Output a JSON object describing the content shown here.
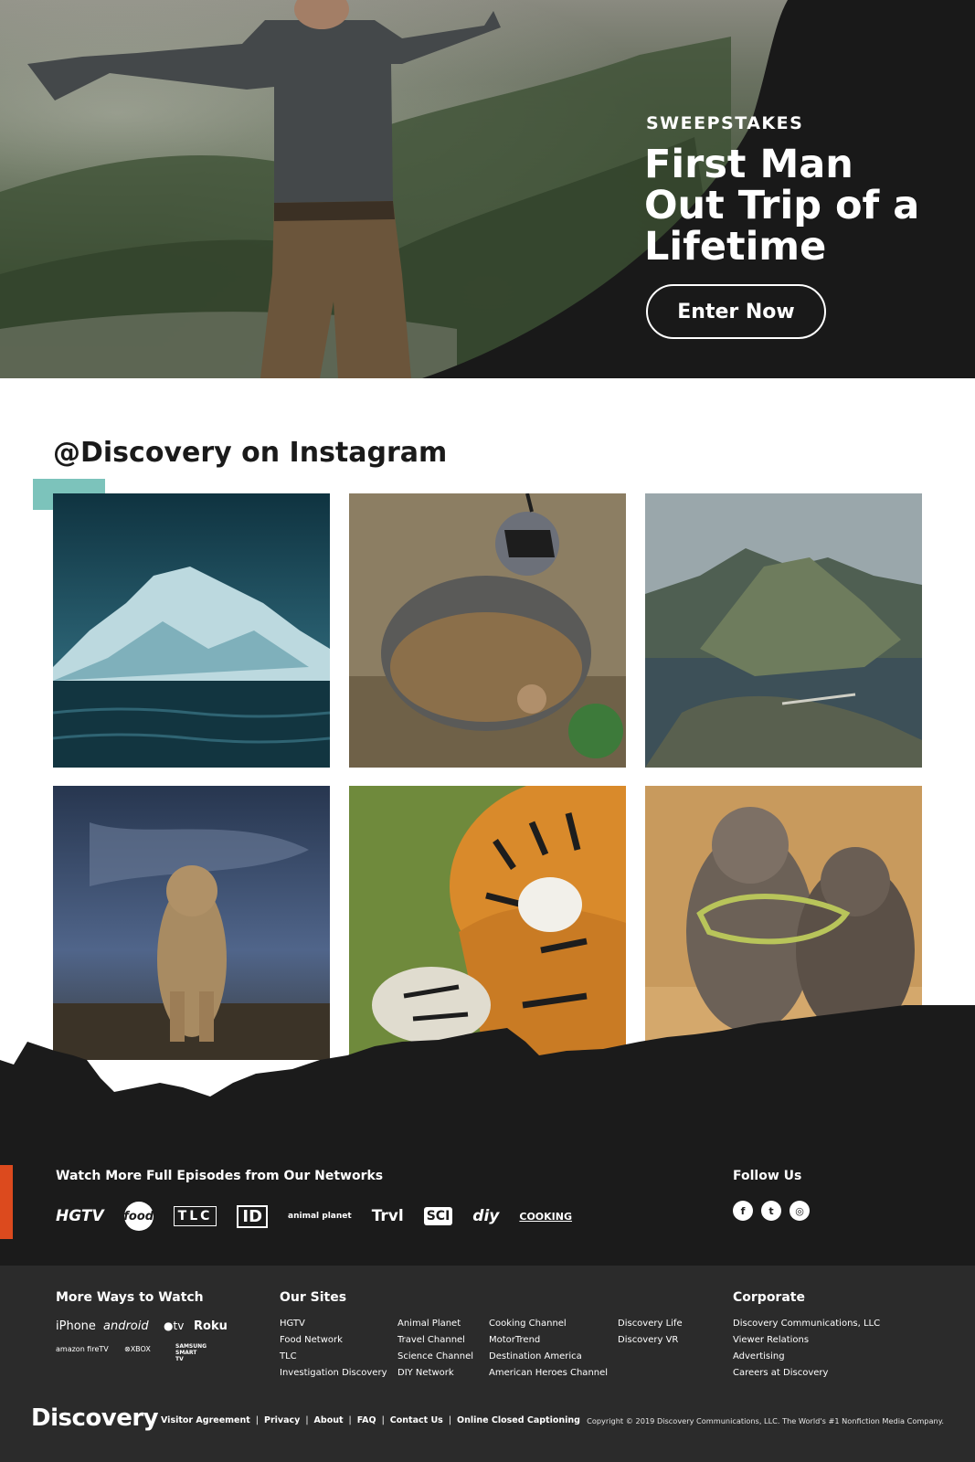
{
  "hero": {
    "eyebrow": "SWEEPSTAKES",
    "title": "First Man Out Trip of a Lifetime",
    "button": "Enter Now"
  },
  "instagram": {
    "heading": "@Discovery on Instagram",
    "accent_color": "#7cc3bb",
    "tiles": [
      "iceberg",
      "quail",
      "fjord",
      "lioness",
      "tiger",
      "seals"
    ]
  },
  "networks": {
    "title": "Watch More Full Episodes from Our Networks",
    "logos": [
      "HGTV",
      "food",
      "TLC",
      "ID",
      "animal planet",
      "Trvl",
      "SCI",
      "diy",
      "COOKING"
    ],
    "accent_color": "#dc4a1e"
  },
  "follow": {
    "title": "Follow Us",
    "icons": [
      "facebook-icon",
      "twitter-icon",
      "instagram-icon"
    ],
    "glyphs": [
      "f",
      "t",
      "◎"
    ]
  },
  "footer": {
    "more_ways": {
      "title": "More Ways to Watch",
      "items": [
        "iPhone",
        "android",
        "tv",
        "Roku",
        "amazon fireTV",
        "XBOX",
        "SAMSUNG SMART TV"
      ]
    },
    "our_sites": {
      "title": "Our Sites",
      "col1": [
        "HGTV",
        "Food Network",
        "TLC",
        "Investigation Discovery"
      ],
      "col2": [
        "Animal Planet",
        "Travel Channel",
        "Science Channel",
        "DIY Network"
      ],
      "col3": [
        "Cooking Channel",
        "MotorTrend",
        "Destination America",
        "American Heroes Channel"
      ],
      "col4": [
        "Discovery Life",
        "Discovery VR"
      ]
    },
    "corporate": {
      "title": "Corporate",
      "items": [
        "Discovery Communications, LLC",
        "Viewer Relations",
        "Advertising",
        "Careers at Discovery"
      ]
    },
    "logo": "Discovery",
    "legal": [
      "Visitor Agreement",
      "Privacy",
      "About",
      "FAQ",
      "Contact Us",
      "Online Closed Captioning"
    ],
    "copyright": "Copyright © 2019 Discovery Communications, LLC. The World's #1 Nonfiction Media Company."
  }
}
